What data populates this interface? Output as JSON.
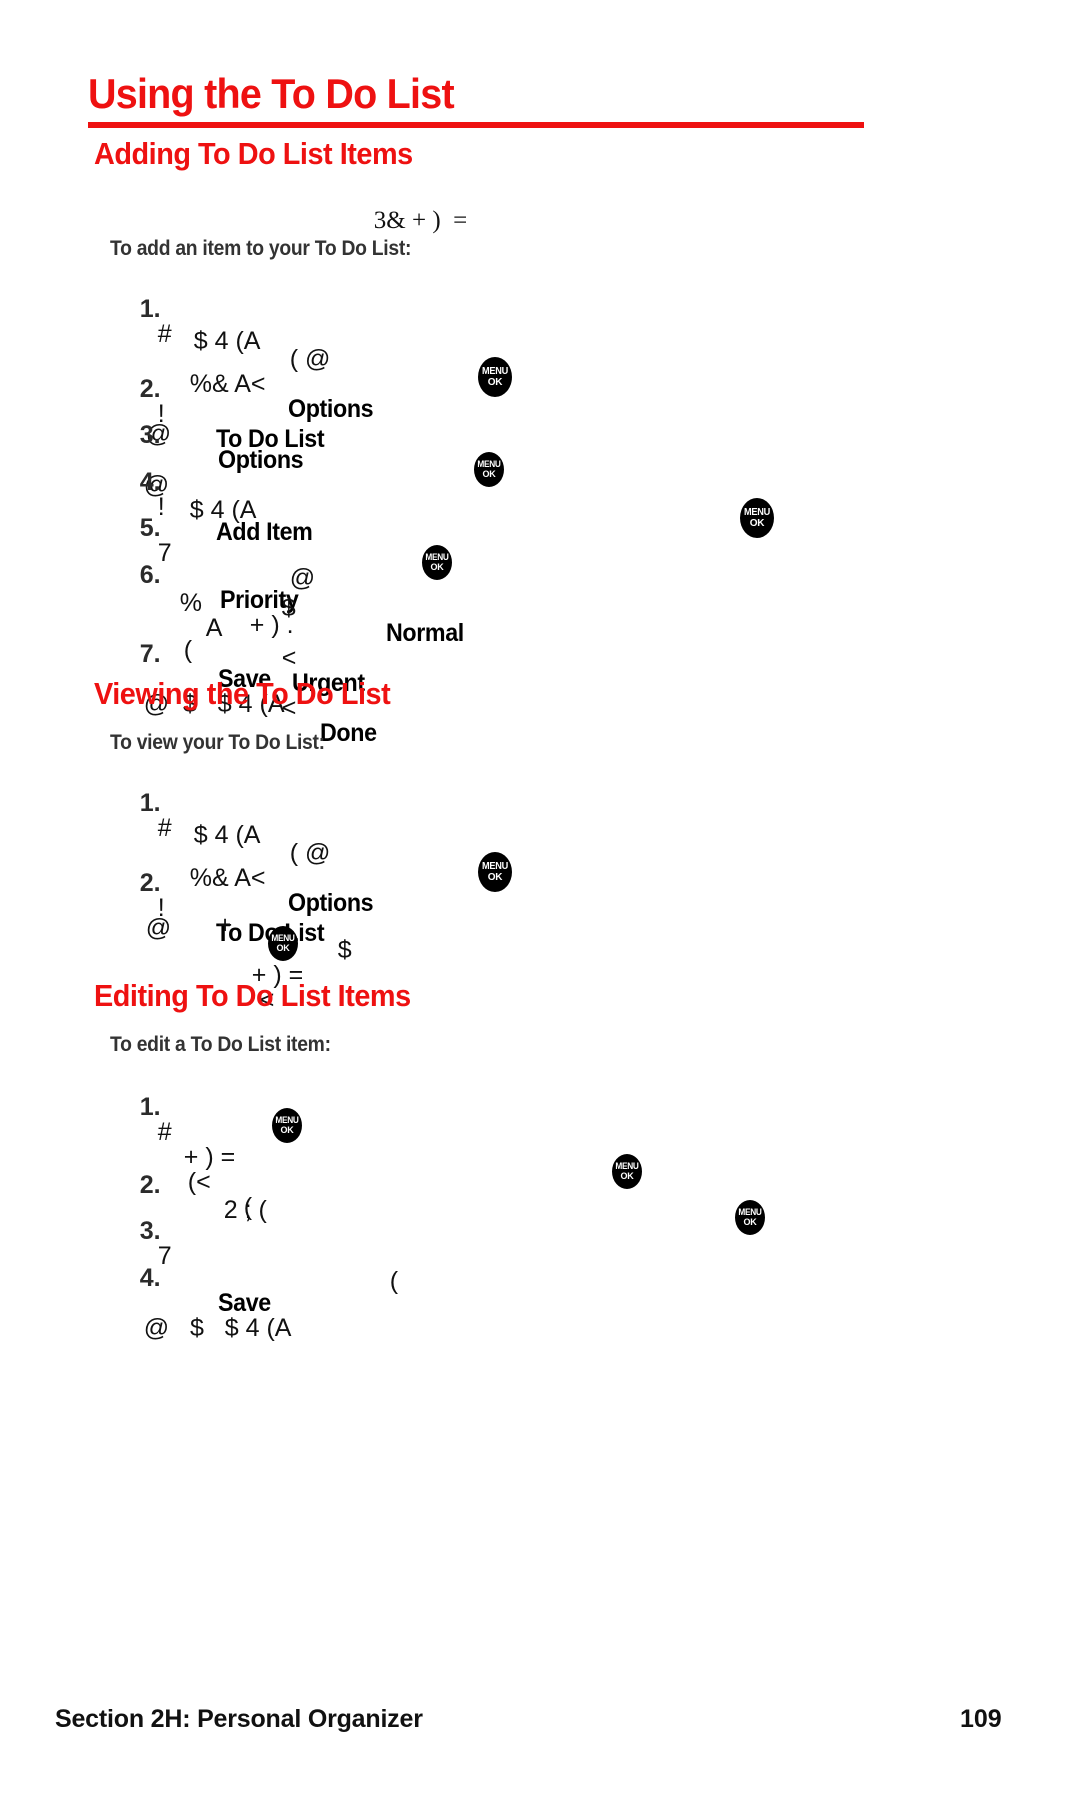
{
  "page": {
    "title": "Using the To Do List",
    "footer_section": "Section 2H: Personal Organizer",
    "footer_page_number": "109",
    "accent_color": "#ee1111",
    "text_color": "#000000"
  },
  "menu_key": {
    "top_label": "MENU",
    "bottom_label": "OK"
  },
  "sections": [
    {
      "heading": "Adding To Do List Items",
      "intro_glyphs": "3& + )  =",
      "lead": "To add an item to your To Do List:",
      "steps": [
        {
          "number": "1.",
          "glyphs_a": "#",
          "glyphs_b": "( @",
          "glyphs_c": "%& A<",
          "ui_term": "Options",
          "glyphs_d": "@",
          "wrap_glyphs": "$ 4 (A"
        },
        {
          "number": "2.",
          "glyphs_a": "!",
          "ui_term": "To Do List"
        },
        {
          "number": "3.",
          "ui_term": "Options",
          "glyphs_b": "@",
          "glyphs_c": "$ 4 (A"
        },
        {
          "number": "4.",
          "glyphs_a": "!",
          "ui_term": "Add Item"
        },
        {
          "number": "5.",
          "glyphs_a": "7",
          "glyphs_b": "@",
          "glyphs_c": "%",
          "glyphs_d": "A"
        },
        {
          "number": "6.",
          "ui_term": "Priority",
          "glyphs_b": "+ ) .",
          "glyphs_c": "(",
          "wrap_glyphs": "$",
          "option_normal": "Normal",
          "sep_1": "<",
          "option_urgent": "Urgent",
          "sep_2": "<",
          "option_done": "Done"
        },
        {
          "number": "7.",
          "ui_term": "Save",
          "glyphs_b": "@  $   $ 4 (A"
        }
      ]
    },
    {
      "heading": "Viewing the To Do List",
      "lead": "To view your To Do List:",
      "steps": [
        {
          "number": "1.",
          "glyphs_a": "#",
          "glyphs_b": "( @",
          "glyphs_c": "%& A<",
          "ui_term": "Options",
          "glyphs_d": "@",
          "wrap_glyphs": "$ 4 (A"
        },
        {
          "number": "2.",
          "glyphs_a": "!",
          "ui_term": "To Do List",
          "wrap_glyphs_a": "+",
          "wrap_glyphs_b": "$",
          "wrap_glyphs_c": "+ ) =",
          "wrap_glyphs_d": "<"
        }
      ]
    },
    {
      "heading": "Editing To Do List Items",
      "lead": "To edit a To Do List item:",
      "steps": [
        {
          "number": "1.",
          "glyphs_a": "#",
          "glyphs_b": "+ ) =",
          "glyphs_c": "(<",
          "glyphs_d": "("
        },
        {
          "number": "2.",
          "glyphs_a": "2 ; ("
        },
        {
          "number": "3.",
          "glyphs_a": "7",
          "glyphs_b": "("
        },
        {
          "number": "4.",
          "ui_term": "Save",
          "glyphs_b": "@   $   $ 4 (A"
        }
      ]
    }
  ]
}
